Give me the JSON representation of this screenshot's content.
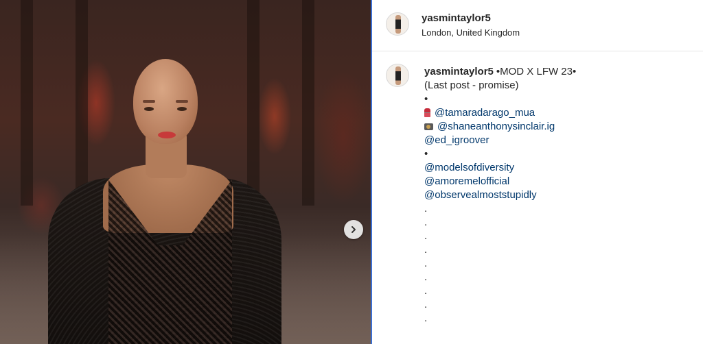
{
  "post": {
    "username": "yasmintaylor5",
    "location": "London, United Kingdom"
  },
  "caption": {
    "username": "yasmintaylor5",
    "title": "•MOD X LFW 23•",
    "lines": [
      {
        "text": "(Last post - promise)",
        "type": "text"
      },
      {
        "text": "•",
        "type": "text"
      },
      {
        "text": "@tamaradarago_mua",
        "type": "mention",
        "icon": "lipstick-icon"
      },
      {
        "text": "@shaneanthonysinclair.ig",
        "type": "mention",
        "icon": "camera-icon"
      },
      {
        "text": "@ed_igroover",
        "type": "mention"
      },
      {
        "text": "•",
        "type": "text"
      },
      {
        "text": "@modelsofdiversity",
        "type": "mention"
      },
      {
        "text": "@amoremelofficial",
        "type": "mention"
      },
      {
        "text": "@observealmoststupidly",
        "type": "mention"
      },
      {
        "text": ".",
        "type": "text"
      },
      {
        "text": ".",
        "type": "text"
      },
      {
        "text": ".",
        "type": "text"
      },
      {
        "text": ".",
        "type": "text"
      },
      {
        "text": ".",
        "type": "text"
      },
      {
        "text": ".",
        "type": "text"
      },
      {
        "text": ".",
        "type": "text"
      },
      {
        "text": ".",
        "type": "text"
      },
      {
        "text": ".",
        "type": "text"
      }
    ]
  },
  "media": {
    "next_icon": "chevron-right-icon"
  },
  "colors": {
    "mention": "#00376b",
    "text": "#262626",
    "divider": "#e4e4e4",
    "accent_border": "#3b6fd4"
  }
}
